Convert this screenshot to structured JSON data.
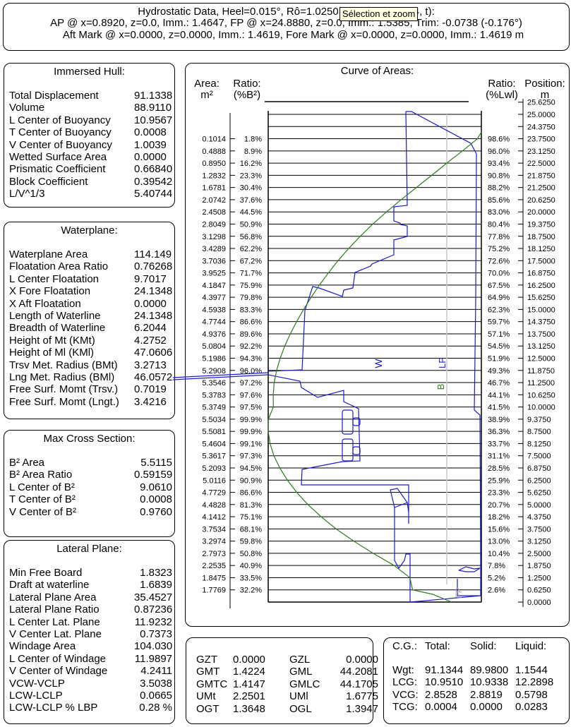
{
  "header": {
    "line1_prefix": "Hydrostatic Data, Heel=0.015°, Rô=1.0250",
    "line1_suffix": "4, t):",
    "line2": "AP @ x=0.8920, z=0.0, Imm.: 1.4647, FP @ x=24.8880, z=0.0, Imm.: 1.5385, Trim: -0.0738 (-0.176°)",
    "line3": "Aft Mark @ x=0.0000, z=0.0000, Imm.: 1.4619, Fore Mark @ x=0.0000, z=0.0000, Imm.: 1.4619 m",
    "tooltip": "Sélection et zoom"
  },
  "immersed_hull": {
    "title": "Immersed Hull:",
    "rows": [
      {
        "label": "Total Displacement",
        "value": "91.1338"
      },
      {
        "label": "Volume",
        "value": "88.9110"
      },
      {
        "label": "L Center of Buoyancy",
        "value": "10.9567"
      },
      {
        "label": "T Center of Buoyancy",
        "value": "0.0008"
      },
      {
        "label": "V Center of Buoyancy",
        "value": "1.0039"
      },
      {
        "label": "Wetted Surface Area",
        "value": "0.0000"
      },
      {
        "label": "Prismatic Coefficient",
        "value": "0.66840"
      },
      {
        "label": "Block Coefficient",
        "value": "0.39542"
      },
      {
        "label": "L/V^1/3",
        "value": "5.40744"
      }
    ]
  },
  "waterplane": {
    "title": "Waterplane:",
    "rows": [
      {
        "label": "Waterplane Area",
        "value": "114.149"
      },
      {
        "label": "Floatation Area Ratio",
        "value": "0.76268"
      },
      {
        "label": "L Center Floatation",
        "value": "9.7017"
      },
      {
        "label": "X Fore Floatation",
        "value": "24.1348"
      },
      {
        "label": "X Aft Floatation",
        "value": "0.0000"
      },
      {
        "label": "Length of Waterline",
        "value": "24.1348"
      },
      {
        "label": "Breadth of Waterline",
        "value": "6.2044"
      },
      {
        "label": "Height of Mt (KMt)",
        "value": "4.2752"
      },
      {
        "label": "Height of Ml (KMl)",
        "value": "47.0606"
      },
      {
        "label": "Trsv Met. Radius (BMt)",
        "value": "3.2713"
      },
      {
        "label": "Lng Met. Radius (BMl)",
        "value": "46.0572"
      },
      {
        "label": "Free Surf. Momt (Trsv.)",
        "value": "0.7019"
      },
      {
        "label": "Free Surf. Momt (Lngt.)",
        "value": "3.4216"
      }
    ]
  },
  "max_cross_section": {
    "title": "Max Cross Section:",
    "rows": [
      {
        "label": "B² Area",
        "value": "5.5115"
      },
      {
        "label": "B² Area Ratio",
        "value": "0.59159"
      },
      {
        "label": "L Center of B²",
        "value": "9.0610"
      },
      {
        "label": "T Center of B²",
        "value": "0.0008"
      },
      {
        "label": "V Center of B²",
        "value": "0.9760"
      }
    ]
  },
  "lateral_plane": {
    "title": "Lateral Plane:",
    "rows": [
      {
        "label": "Min Free Board",
        "value": "1.8323"
      },
      {
        "label": "Draft at waterline",
        "value": "1.6839"
      },
      {
        "label": "Lateral Plane Area",
        "value": "35.4527"
      },
      {
        "label": "Lateral Plane Ratio",
        "value": "0.87236"
      },
      {
        "label": "L Center Lat. Plane",
        "value": "11.9232"
      },
      {
        "label": "V Center Lat. Plane",
        "value": "0.7373"
      },
      {
        "label": "Windage Area",
        "value": "104.030"
      },
      {
        "label": "L Center of Windage",
        "value": "11.9897"
      },
      {
        "label": "V Center of Windage",
        "value": "4.2411"
      },
      {
        "label": "VCW-VCLP",
        "value": "3.5038"
      },
      {
        "label": "LCW-LCLP",
        "value": "0.0665"
      },
      {
        "label": "LCW-LCLP % LBP",
        "value": "0.28 %"
      }
    ]
  },
  "stability": {
    "rows": [
      {
        "k1": "GZT",
        "v1": "0.0000",
        "k2": "GZL",
        "v2": "0.0000"
      },
      {
        "k1": "GMT",
        "v1": "1.4224",
        "k2": "GML",
        "v2": "44.2081"
      },
      {
        "k1": "GMTC",
        "v1": "1.4147",
        "k2": "GMLC",
        "v2": "44.1705"
      },
      {
        "k1": "UMt",
        "v1": "2.2501",
        "k2": "UMl",
        "v2": "1.6775"
      },
      {
        "k1": "OGT",
        "v1": "1.3648",
        "k2": "OGL",
        "v2": "1.3947"
      }
    ]
  },
  "cg": {
    "headers": [
      "C.G.:",
      "Total:",
      "Solid:",
      "Liquid:"
    ],
    "rows": [
      [
        "Wgt:",
        "91.1344",
        "89.9800",
        "1.1544"
      ],
      [
        "LCG:",
        "10.9510",
        "10.9338",
        "12.2898"
      ],
      [
        "VCG:",
        "2.8528",
        "2.8819",
        "0.5798"
      ],
      [
        "TCG:",
        "0.0004",
        "0.0000",
        "0.0283"
      ]
    ]
  },
  "curve_of_areas": {
    "title": "Curve of Areas:",
    "area_header": "Area:",
    "area_unit": "m²",
    "ratio_b2_header": "Ratio:",
    "ratio_b2_unit": "(%B²)",
    "ratio_lwl_header": "Ratio:",
    "ratio_lwl_unit": "(%Lwl)",
    "position_header": "Position:",
    "position_unit": "m",
    "markers": {
      "w": "W",
      "lp": "LP",
      "b": "B",
      "fp": "FP"
    },
    "colors": {
      "hull": "#1a1acc",
      "area_curve": "#2e7d1e",
      "fp_line": "#c8c8c8",
      "grid": "#000000"
    },
    "positions": [
      "25.6250",
      "25.0000",
      "24.3750",
      "23.7500",
      "23.1250",
      "22.5000",
      "21.8750",
      "21.2500",
      "20.6250",
      "20.0000",
      "19.3750",
      "18.7500",
      "18.1250",
      "17.5000",
      "16.8750",
      "16.2500",
      "15.6250",
      "15.0000",
      "14.3750",
      "13.7500",
      "13.1250",
      "12.5000",
      "11.8750",
      "11.2500",
      "10.6250",
      "10.0000",
      "9.3750",
      "8.7500",
      "8.1250",
      "7.5000",
      "6.8750",
      "6.2500",
      "5.6250",
      "5.0000",
      "4.3750",
      "3.7500",
      "3.1250",
      "2.5000",
      "1.8750",
      "1.2500",
      "0.6250",
      "0.0000"
    ],
    "areas": [
      "0.1014",
      "0.4888",
      "0.8950",
      "1.2832",
      "1.6781",
      "2.0742",
      "2.4508",
      "2.8049",
      "3.1298",
      "3.4289",
      "3.7036",
      "3.9525",
      "4.1847",
      "4.3977",
      "4.5938",
      "4.7744",
      "4.9376",
      "5.0804",
      "5.1986",
      "5.2908",
      "5.3546",
      "5.3783",
      "5.3749",
      "5.5034",
      "5.5081",
      "5.4604",
      "5.3617",
      "5.2093",
      "5.0116",
      "4.7729",
      "4.4828",
      "4.1412",
      "3.7534",
      "3.2974",
      "2.7973",
      "2.2535",
      "1.8475",
      "1.7769"
    ],
    "ratio_b2": [
      "1.8%",
      "8.9%",
      "16.2%",
      "23.3%",
      "30.4%",
      "37.6%",
      "44.5%",
      "50.9%",
      "56.8%",
      "62.2%",
      "67.2%",
      "71.7%",
      "75.9%",
      "79.8%",
      "83.3%",
      "86.6%",
      "89.6%",
      "92.2%",
      "94.3%",
      "96.0%",
      "97.2%",
      "97.6%",
      "97.5%",
      "99.9%",
      "99.9%",
      "99.1%",
      "97.3%",
      "94.5%",
      "90.9%",
      "86.6%",
      "81.3%",
      "75.1%",
      "68.1%",
      "59.8%",
      "50.8%",
      "40.9%",
      "33.5%",
      "32.2%"
    ],
    "ratio_lwl": [
      "98.6%",
      "96.0%",
      "93.4%",
      "90.8%",
      "88.2%",
      "85.6%",
      "83.0%",
      "80.4%",
      "77.8%",
      "75.2%",
      "72.6%",
      "70.0%",
      "67.5%",
      "64.9%",
      "62.3%",
      "59.7%",
      "57.1%",
      "54.5%",
      "51.9%",
      "49.3%",
      "46.7%",
      "44.1%",
      "41.5%",
      "38.9%",
      "36.3%",
      "33.7%",
      "31.1%",
      "28.5%",
      "25.9%",
      "23.3%",
      "20.7%",
      "18.2%",
      "15.6%",
      "13.0%",
      "10.4%",
      "7.8%",
      "5.2%",
      "2.6%"
    ]
  }
}
